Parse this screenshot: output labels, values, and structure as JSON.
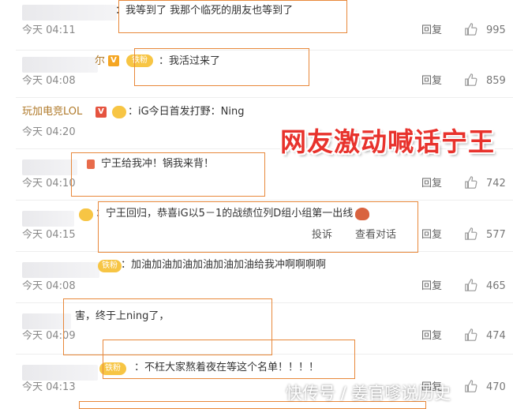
{
  "comments": [
    {
      "name": "",
      "content": "：我等到了 我那个临死的朋友也等到了",
      "time": "今天 04:11",
      "reply": "回复",
      "likes": "995"
    },
    {
      "name": "尔",
      "fan": "铁粉",
      "content": "：我活过来了",
      "time": "今天 04:08",
      "reply": "回复",
      "likes": "859"
    },
    {
      "name": "玩加电竞LOL",
      "content": "：iG今日首发打野：Ning",
      "time": "今天 04:20",
      "reply": "回复",
      "likes": ""
    },
    {
      "name": "",
      "content": "宁王给我冲！锅我来背！",
      "time": "今天 04:10",
      "reply": "回复",
      "likes": "742"
    },
    {
      "name": "",
      "content": "：宁王回归，恭喜iG以5－1的战绩位列D组小组第一出线",
      "time": "今天 04:15",
      "report": "投诉",
      "view": "查看对话",
      "reply": "回复",
      "likes": "577"
    },
    {
      "name": "",
      "fan": "铁粉",
      "content": "：加油加油加油加油加油加油给我冲啊啊啊啊",
      "time": "今天 04:08",
      "reply": "回复",
      "likes": "465"
    },
    {
      "name": "",
      "content": "害，终于上ning了，",
      "time": "今天 04:09",
      "reply": "回复",
      "likes": "474"
    },
    {
      "name": "",
      "fan": "铁粉",
      "content": "：不枉大家熬着夜在等这个名单！！！！",
      "time": "今天 04:13",
      "reply": "回复",
      "likes": "470"
    }
  ],
  "overlay": {
    "headline": "网友激动喊话宁王",
    "watermark": "快传号 / 姜官嗲说历史"
  },
  "colors": {
    "highlight_box": "#e8883a",
    "headline": "#e8322c",
    "verified_name": "#b07a2a"
  },
  "icons": {
    "like": "thumbs-up-icon",
    "verified": "verified-v-icon",
    "fan_badge": "fan-badge-icon"
  }
}
